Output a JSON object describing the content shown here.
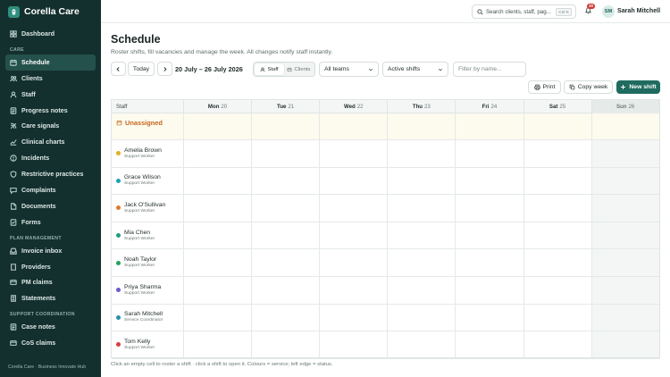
{
  "app": {
    "name": "Corella Care",
    "footer": "Corella Care · Business Innovate Hub"
  },
  "sidebar": {
    "top_items": [
      {
        "label": "Dashboard",
        "icon": "grid-icon"
      }
    ],
    "sections": [
      {
        "title": "CARE",
        "items": [
          {
            "label": "Schedule",
            "icon": "calendar-icon",
            "active": true
          },
          {
            "label": "Clients",
            "icon": "users-icon"
          },
          {
            "label": "Staff",
            "icon": "user-icon"
          },
          {
            "label": "Progress notes",
            "icon": "notes-icon"
          },
          {
            "label": "Care signals",
            "icon": "signal-icon"
          },
          {
            "label": "Clinical charts",
            "icon": "chart-icon"
          },
          {
            "label": "Incidents",
            "icon": "alert-icon"
          },
          {
            "label": "Restrictive practices",
            "icon": "shield-icon"
          },
          {
            "label": "Complaints",
            "icon": "message-icon"
          },
          {
            "label": "Documents",
            "icon": "document-icon"
          },
          {
            "label": "Forms",
            "icon": "form-icon"
          }
        ]
      },
      {
        "title": "PLAN MANAGEMENT",
        "items": [
          {
            "label": "Invoice inbox",
            "icon": "inbox-icon"
          },
          {
            "label": "Providers",
            "icon": "building-icon"
          },
          {
            "label": "PM claims",
            "icon": "claim-icon"
          },
          {
            "label": "Statements",
            "icon": "statement-icon"
          }
        ]
      },
      {
        "title": "SUPPORT COORDINATION",
        "items": [
          {
            "label": "Case notes",
            "icon": "notes-icon"
          },
          {
            "label": "CoS claims",
            "icon": "claim-icon"
          }
        ]
      }
    ]
  },
  "topbar": {
    "search_placeholder": "Search clients, staff, pag...",
    "search_shortcut": "Ctrl K",
    "notification_count": "30",
    "user_initials": "SM",
    "user_name": "Sarah Mitchell"
  },
  "page": {
    "title": "Schedule",
    "subtitle": "Roster shifts, fill vacancies and manage the week. All changes notify staff instantly."
  },
  "toolbar": {
    "today_label": "Today",
    "date_range": "20 July – 26 July 2026",
    "view_staff": "Staff",
    "view_clients": "Clients",
    "team_select": "All teams",
    "shift_select": "Active shifts",
    "filter_placeholder": "Filter by name...",
    "print_label": "Print",
    "copy_week_label": "Copy week",
    "new_shift_label": "New shift"
  },
  "grid": {
    "staff_header": "Staff",
    "days": [
      {
        "day": "Mon",
        "date": "20"
      },
      {
        "day": "Tue",
        "date": "21"
      },
      {
        "day": "Wed",
        "date": "22"
      },
      {
        "day": "Thu",
        "date": "23"
      },
      {
        "day": "Fri",
        "date": "24"
      },
      {
        "day": "Sat",
        "date": "25"
      },
      {
        "day": "Sun",
        "date": "26"
      }
    ],
    "unassigned_label": "Unassigned",
    "staff": [
      {
        "name": "Amelia Brown",
        "role": "Support Worker",
        "color": "#e0b020"
      },
      {
        "name": "Grace Wilson",
        "role": "Support Worker",
        "color": "#1aa3b8"
      },
      {
        "name": "Jack O'Sullivan",
        "role": "Support Worker",
        "color": "#e07a2a"
      },
      {
        "name": "Mia Chen",
        "role": "Support Worker",
        "color": "#1f9e86"
      },
      {
        "name": "Noah Taylor",
        "role": "Support Worker",
        "color": "#25a05a"
      },
      {
        "name": "Priya Sharma",
        "role": "Support Worker",
        "color": "#6a5acd"
      },
      {
        "name": "Sarah Mitchell",
        "role": "Service Coordinator",
        "color": "#2a8fb0"
      },
      {
        "name": "Tom Kelly",
        "role": "Support Worker",
        "color": "#d04040"
      }
    ]
  },
  "footer_note": "Click an empty cell to roster a shift · click a shift to open it. Colours = service; left edge = status."
}
